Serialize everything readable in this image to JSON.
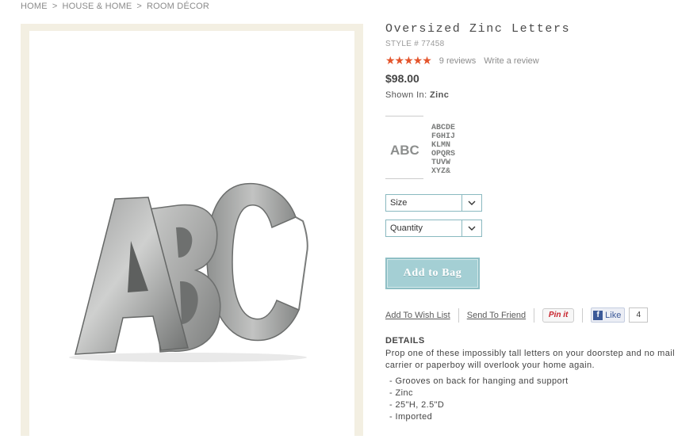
{
  "breadcrumb": {
    "items": [
      "HOME",
      "HOUSE & HOME",
      "ROOM DÉCOR"
    ],
    "separator": ">"
  },
  "product": {
    "title": "Oversized Zinc Letters",
    "style_number": "STYLE # 77458",
    "rating": 4.5,
    "stars_display": "★★★★★",
    "reviews_text": "9 reviews",
    "write_review": "Write a review",
    "price": "$98.00",
    "shown_in_label": "Shown In:",
    "shown_in_value": "Zinc",
    "size_select": "Size",
    "quantity_select": "Quantity",
    "add_to_bag": "Add to Bag",
    "wish_list": "Add To Wish List",
    "send_friend": "Send To Friend",
    "pin_it": "Pin it",
    "like": "Like",
    "like_count": "4",
    "details_heading": "DETAILS",
    "description": "Prop one of these impossibly tall letters on your doorstep and no mail carrier or paperboy will overlook your home again.",
    "bullets": [
      "Grooves on back for hanging and support",
      "Zinc",
      "25\"H, 2.5\"D",
      "Imported"
    ]
  },
  "thumbs": {
    "thumb1_text": "ABC",
    "thumb2_lines": [
      "ABCDE",
      "FGHIJ",
      "KLMN",
      "OPQRS",
      "TUVW",
      "XYZ&"
    ]
  },
  "colors": {
    "star": "#e4552c",
    "button": "#a4cfd4",
    "select_border": "#8ab9c0",
    "frame": "#f3efe2"
  },
  "icons": {
    "dropdown": "chevron-down-icon",
    "facebook": "facebook-icon"
  }
}
